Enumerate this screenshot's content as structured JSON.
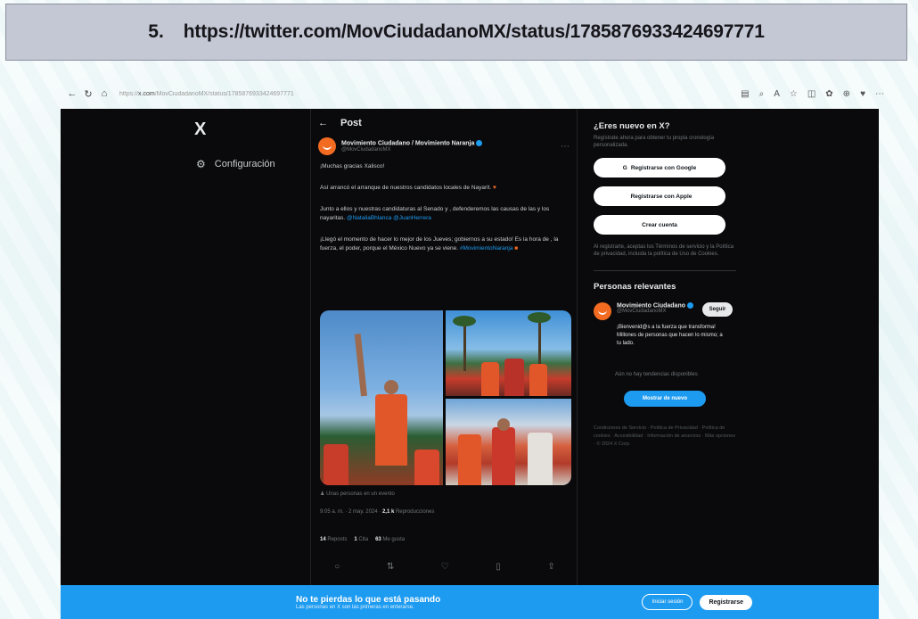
{
  "document_header": {
    "number": "5.",
    "url": "https://twitter.com/MovCiudadanoMX/status/1785876933424697771"
  },
  "browser": {
    "address_prefix": "https://",
    "address_domain": "x.com",
    "address_path": "/MovCiudadanoMX/status/1785876933424697771",
    "back_icon": "back-arrow-icon",
    "refresh_icon": "refresh-icon"
  },
  "left_nav": {
    "logo": "X",
    "settings_label": "Configuración"
  },
  "post": {
    "header_title": "Post",
    "author_name": "Movimiento Ciudadano / Movimiento Naranja",
    "author_handle": "@MovCiudadanoMX",
    "paragraph_1": "¡Muchas gracias Xalisco!",
    "paragraph_2": "Así arrancó el arranque de nuestros candidatos locales de Nayarit.",
    "paragraph_3": "Junto a ellos y nuestras candidaturas al Senado y , defenderemos las causas de las y los nayaritas.",
    "paragraph_3_link_1": "@NataliaBhlanca",
    "paragraph_3_link_2": "@JuanHerrera",
    "paragraph_4": "¡Llegó el momento de hacer lo mejor de los Jueves; gobiernos a su estado! Es la hora de , la fuerza, el poder, porque el México Nuevo ya se viene.",
    "paragraph_4_link": "#MovimientoNaranja",
    "audience_line": "Unas personas en un evento",
    "timestamp": "9:05 a. m. · 2 may. 2024 ·",
    "views_count": "2,1 k",
    "views_label": "Reproducciones",
    "reposts_count": "14",
    "reposts_label": "Reposts",
    "quotes_count": "1",
    "quotes_label": "Cita",
    "likes_count": "63",
    "likes_label": "Me gusta"
  },
  "sidebar": {
    "new_title": "¿Eres nuevo en X?",
    "new_subtitle": "Regístrate ahora para obtener tu propia cronología personalizada.",
    "google_button": "Registrarse con Google",
    "apple_button": "Registrarse con Apple",
    "create_button": "Crear cuenta",
    "terms_text": "Al registrarte, aceptas los Términos de servicio y la Política de privacidad, incluida la política de Uso de Cookies.",
    "people_title": "Personas relevantes",
    "person_name": "Movimiento Ciudadano",
    "person_handle": "@MovCiudadanoMX",
    "follow_button": "Seguir",
    "person_bio": "¡Bienvenid@s a la fuerza que transforma! Millones de personas que hacen lo mismo; a tu lado.",
    "trends_note": "Aún no hay tendencias disponibles",
    "trends_button": "Mostrar de nuevo",
    "footer_links": "Condiciones de Servicio · Política de Privacidad · Política de cookies · Accesibilidad · Información de anuncios · Más opciones · © 2024 X Corp."
  },
  "banner": {
    "title": "No te pierdas lo que está pasando",
    "subtitle": "Las personas en X son las primeras en enterarse.",
    "login_button": "Iniciar sesión",
    "register_button": "Registrarse"
  }
}
